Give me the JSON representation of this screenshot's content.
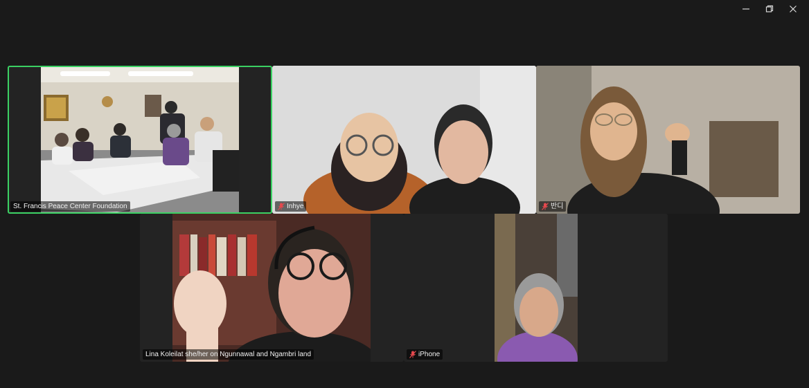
{
  "window": {
    "controls": [
      {
        "name": "minimize-button",
        "glyph": "—"
      },
      {
        "name": "restore-button",
        "glyph": "❐"
      },
      {
        "name": "close-button",
        "glyph": "✕"
      }
    ]
  },
  "participants": [
    {
      "name": "St. Francis Peace Center Foundation",
      "muted": false,
      "active": true
    },
    {
      "name": "Inhye",
      "muted": true,
      "active": false
    },
    {
      "name": "반디",
      "muted": true,
      "active": false
    },
    {
      "name": "Lina Koleilat she/her on Ngunnawal and Ngambri land",
      "muted": false,
      "active": false
    },
    {
      "name": "iPhone",
      "muted": true,
      "active": false
    }
  ],
  "colors": {
    "background": "#1a1a1a",
    "tile": "#232323",
    "active_speaker": "#3bd163",
    "muted_icon": "#e5484d"
  }
}
